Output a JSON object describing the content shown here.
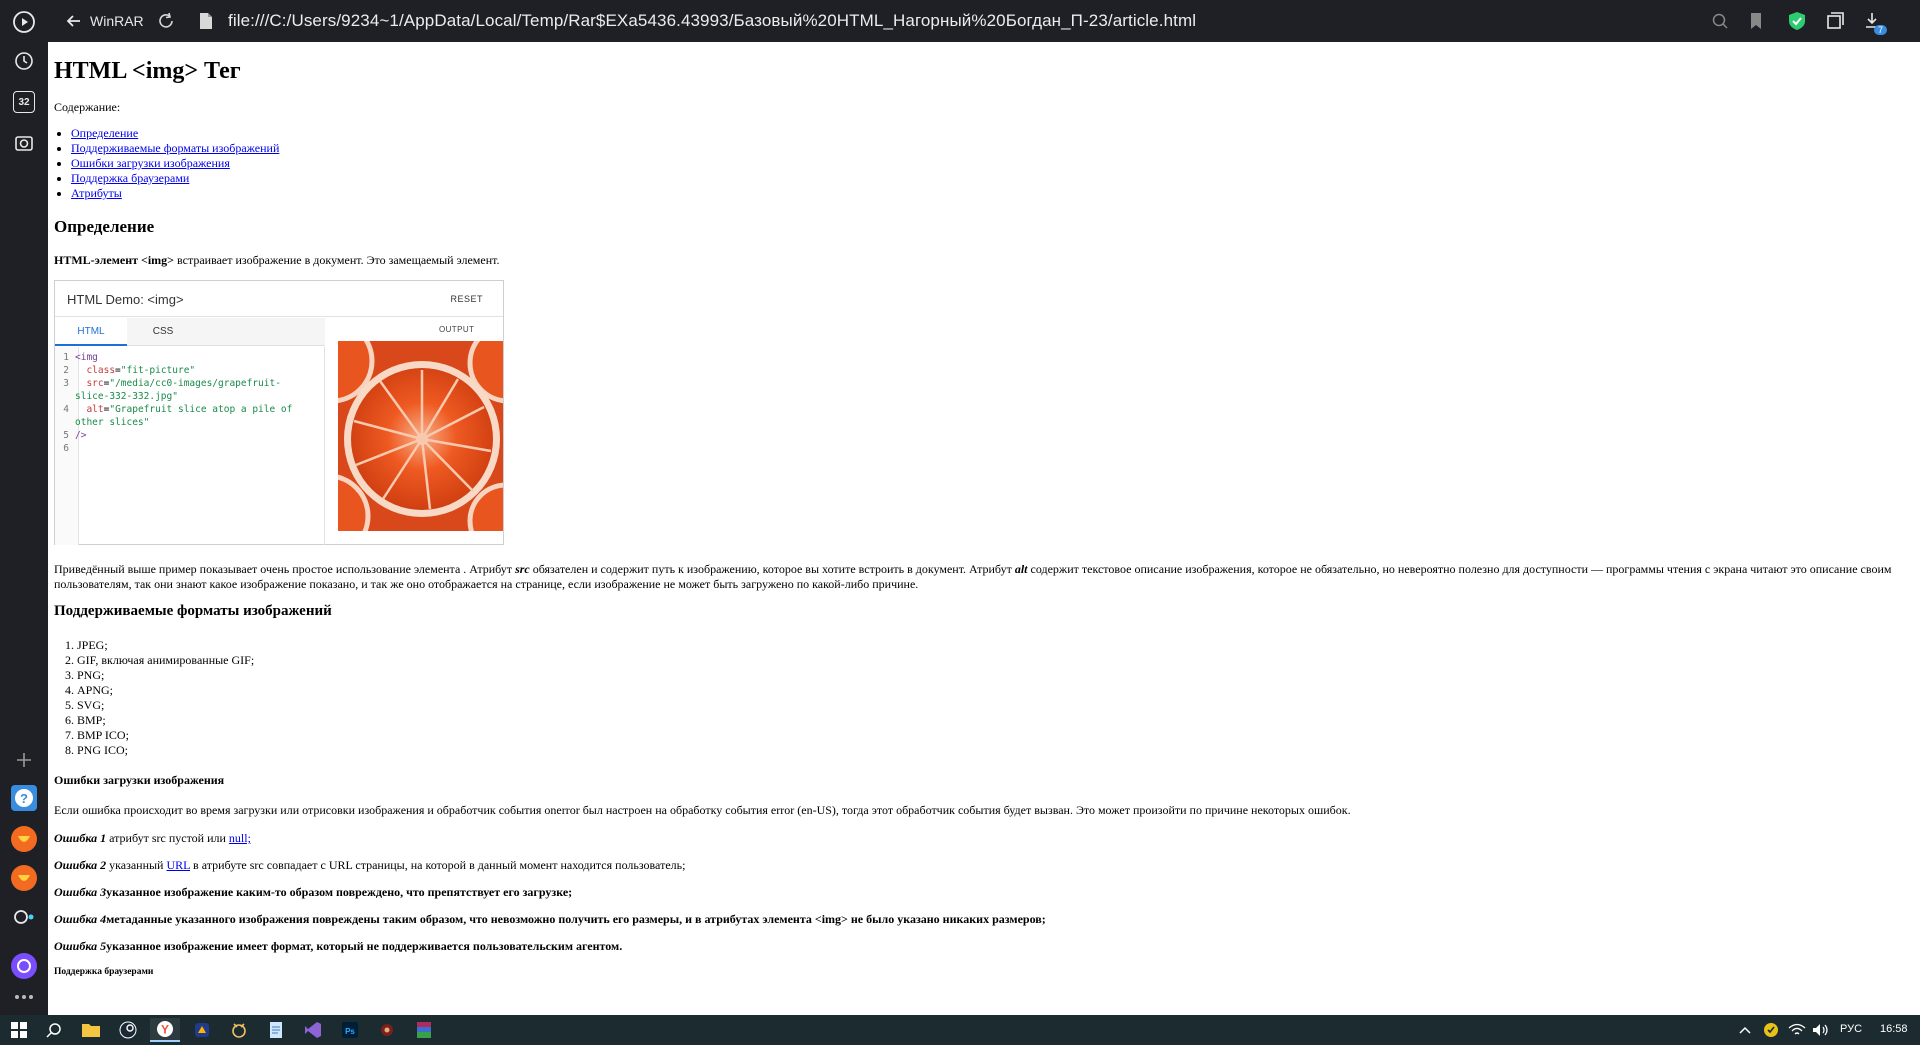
{
  "browser": {
    "back_label": "WinRAR",
    "url": "file:///C:/Users/9234~1/AppData/Local/Temp/Rar$EXa5436.43993/Базовый%20HTML_Нагорный%20Богдан_П-23/article.html",
    "calendar_badge": "32",
    "download_badge": "7"
  },
  "article": {
    "title": "HTML <img> Тег",
    "toc_label": "Содержание:",
    "toc": [
      "Определение",
      "Поддерживаемые форматы изображений",
      "Ошибки загрузки изображения",
      "Поддержка браузерами",
      "Атрибуты"
    ],
    "section1_title": "Определение",
    "definition_bold": "HTML-элемент <img>",
    "definition_rest": " встраивает изображение в документ. Это замещаемый элемент.",
    "demo": {
      "title": "HTML Demo: <img>",
      "reset": "RESET",
      "tab_html": "HTML",
      "tab_css": "CSS",
      "output": "OUTPUT",
      "code_lines": [
        {
          "n": "1",
          "parts": [
            {
              "c": "tag",
              "t": "<img"
            }
          ]
        },
        {
          "n": "2",
          "parts": [
            {
              "c": "attr",
              "t": "  class"
            },
            {
              "c": "plain",
              "t": "="
            },
            {
              "c": "str",
              "t": "\"fit-picture\""
            }
          ]
        },
        {
          "n": "3",
          "parts": [
            {
              "c": "attr",
              "t": "  src"
            },
            {
              "c": "plain",
              "t": "="
            },
            {
              "c": "str",
              "t": "\"/media/cc0-images/grapefruit-"
            }
          ]
        },
        {
          "n": "",
          "parts": [
            {
              "c": "str",
              "t": "slice-332-332.jpg\""
            }
          ]
        },
        {
          "n": "4",
          "parts": [
            {
              "c": "attr",
              "t": "  alt"
            },
            {
              "c": "plain",
              "t": "="
            },
            {
              "c": "str",
              "t": "\"Grapefruit slice atop a pile of"
            }
          ]
        },
        {
          "n": "",
          "parts": [
            {
              "c": "str",
              "t": "other slices\""
            }
          ]
        },
        {
          "n": "5",
          "parts": [
            {
              "c": "tag",
              "t": "/>"
            }
          ]
        },
        {
          "n": "6",
          "parts": []
        }
      ]
    },
    "description_a": "Приведённый выше пример показывает очень простое использование элемента . Атрибут ",
    "description_src": "src",
    "description_b": " обязателен и содержит путь к изображению, которое вы хотите встроить в документ. Атрибут ",
    "description_alt": "alt",
    "description_c": " содержит текстовое описание изображения, которое не обязательно, но невероятно полезно для доступности — программы чтения с экрана читают это описание своим пользователям, так они знают какое изображение показано, и так же оно отображается на странице, если изображение не может быть загружено по какой-либо причине.",
    "section2_title": "Поддерживаемые форматы изображений",
    "formats": [
      "JPEG;",
      "GIF, включая анимированные GIF;",
      "PNG;",
      "APNG;",
      "SVG;",
      "BMP;",
      "BMP ICO;",
      "PNG ICO;"
    ],
    "section3_title": "Ошибки загрузки изображения",
    "errors_intro": "Если ошибка происходит во время загрузки или отрисовки изображения и обработчик события onerror был настроен на обработку события error (en-US), тогда этот обработчик события будет вызван. Это может произойти по причине некоторых ошибок.",
    "error1_label": "Ошибка 1",
    "error1_text": " атрибут src пустой или ",
    "error1_link": "null;",
    "error2_label": "Ошибка 2",
    "error2_text_a": " указанный ",
    "error2_link": "URL",
    "error2_text_b": " в атрибуте src совпадает с URL страницы, на которой в данный момент находится пользователь;",
    "error3_label": "Ошибка 3",
    "error3_text": "указанное изображение каким-то образом повреждено, что препятствует его загрузке;",
    "error4_label": "Ошибка 4",
    "error4_text": "метаданные указанного изображения повреждены таким образом, что невозможно получить его размеры, и в атрибутах элемента <img> не было указано никаких размеров;",
    "error5_label": "Ошибка 5",
    "error5_text": "указанное изображение имеет формат, который не поддерживается пользовательским агентом.",
    "section4_title": "Поддержка браузерами"
  },
  "taskbar": {
    "language": "РУС",
    "time": "16:58"
  }
}
